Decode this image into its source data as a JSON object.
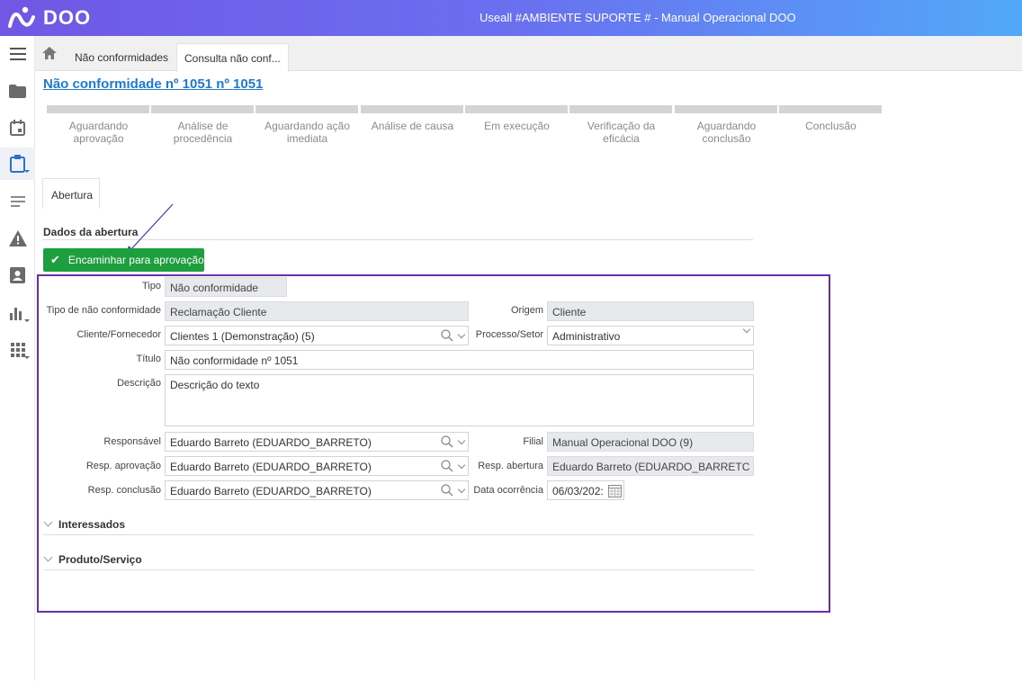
{
  "app": {
    "logo_text": "DOO",
    "window_title": "Useall #AMBIENTE SUPORTE # - Manual Operacional DOO"
  },
  "sidebar": {
    "items": [
      {
        "icon": "menu-icon"
      },
      {
        "icon": "folder-icon"
      },
      {
        "icon": "calendar-icon"
      },
      {
        "icon": "clipboard-icon",
        "active": true
      },
      {
        "icon": "list-icon"
      },
      {
        "icon": "warning-icon"
      },
      {
        "icon": "contact-card-icon"
      },
      {
        "icon": "bar-chart-icon"
      },
      {
        "icon": "grid-apps-icon"
      }
    ]
  },
  "breadcrumb": {
    "home_icon": "home-icon",
    "tabs": [
      {
        "label": "Não conformidades"
      },
      {
        "label": "Consulta não conf..."
      }
    ]
  },
  "page": {
    "title": "Não conformidade nº 1051 nº 1051"
  },
  "steps": [
    "Aguardando aprovação",
    "Análise de procedência",
    "Aguardando ação imediata",
    "Análise de causa",
    "Em execução",
    "Verificação da eficácia",
    "Aguardando conclusão",
    "Conclusão"
  ],
  "section": {
    "tab_label": "Abertura",
    "heading": "Dados da abertura",
    "action_button": "Encaminhar para aprovação"
  },
  "form": {
    "tipo": {
      "label": "Tipo",
      "value": "Não conformidade"
    },
    "tipo_nc": {
      "label": "Tipo de não conformidade",
      "value": "Reclamação Cliente"
    },
    "origem": {
      "label": "Origem",
      "value": "Cliente"
    },
    "cliente": {
      "label": "Cliente/Fornecedor",
      "value": "Clientes 1 (Demonstração) (5)"
    },
    "processo": {
      "label": "Processo/Setor",
      "value": "Administrativo"
    },
    "titulo": {
      "label": "Título",
      "value": "Não conformidade nº 1051"
    },
    "descricao": {
      "label": "Descrição",
      "value": "Descrição do texto"
    },
    "responsavel": {
      "label": "Responsável",
      "value": "Eduardo Barreto  (EDUARDO_BARRETO)"
    },
    "filial": {
      "label": "Filial",
      "value": "Manual Operacional DOO (9)"
    },
    "resp_aprovacao": {
      "label": "Resp. aprovação",
      "value": "Eduardo Barreto  (EDUARDO_BARRETO)"
    },
    "resp_abertura": {
      "label": "Resp. abertura",
      "value": "Eduardo Barreto  (EDUARDO_BARRETC"
    },
    "resp_conclusao": {
      "label": "Resp. conclusão",
      "value": "Eduardo Barreto  (EDUARDO_BARRETO)"
    },
    "data_ocorrencia": {
      "label": "Data ocorrência",
      "value": "06/03/202:"
    }
  },
  "groups": [
    {
      "label": "Interessados"
    },
    {
      "label": "Produto/Serviço"
    }
  ],
  "colors": {
    "accent_purple": "#6b2ea6",
    "link_blue": "#1f7ad1",
    "button_green": "#1e9f3f"
  }
}
